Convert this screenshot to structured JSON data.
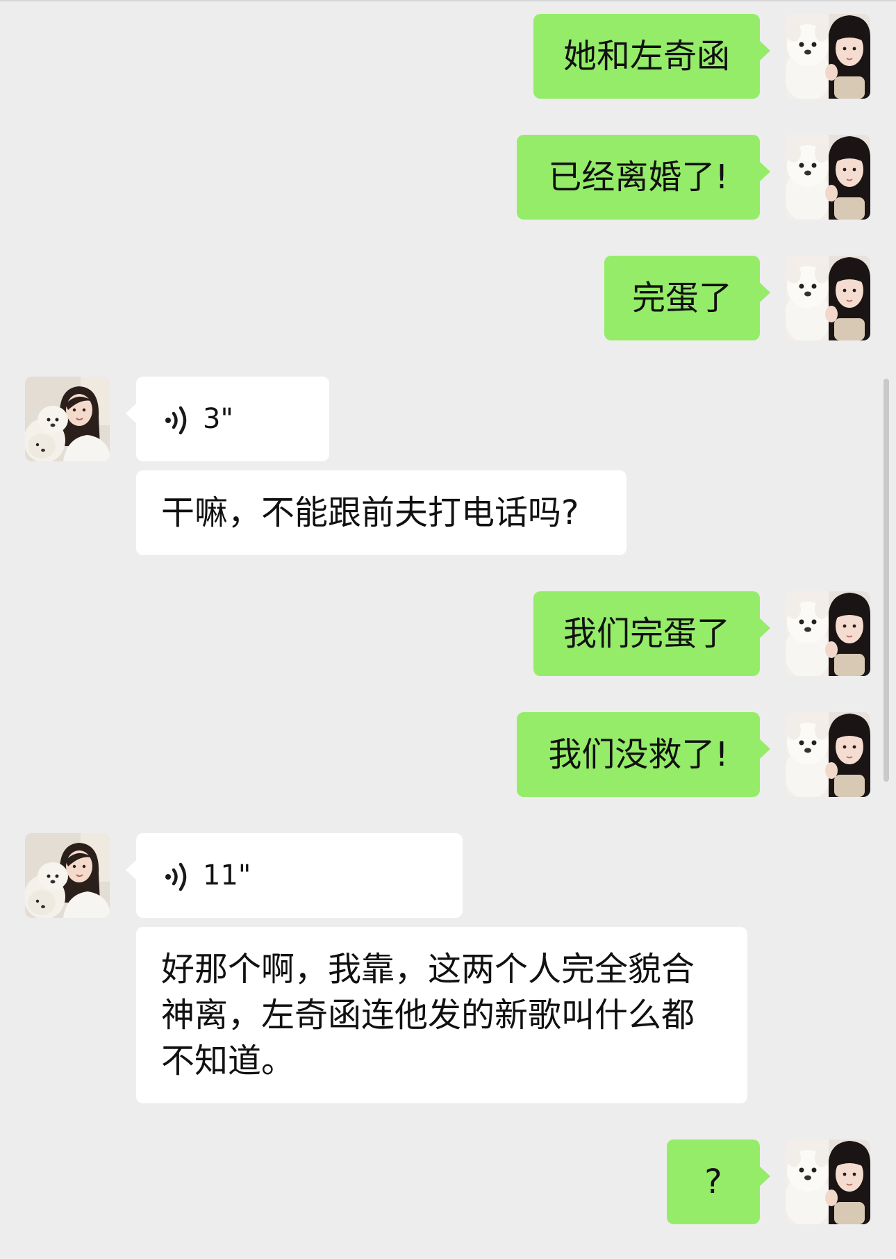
{
  "messages": [
    {
      "side": "right",
      "text": "她和左奇函"
    },
    {
      "side": "right",
      "text": "已经离婚了!"
    },
    {
      "side": "right",
      "text": "完蛋了"
    },
    {
      "side": "left",
      "type": "voice",
      "duration": "3\""
    },
    {
      "side": "left",
      "text": "干嘛，不能跟前夫打电话吗?"
    },
    {
      "side": "right",
      "text": "我们完蛋了"
    },
    {
      "side": "right",
      "text": "我们没救了!"
    },
    {
      "side": "left",
      "type": "voice",
      "duration": "11\""
    },
    {
      "side": "left",
      "text": "好那个啊，我靠，这两个人完全貌合神离，左奇函连他发的新歌叫什么都不知道。"
    },
    {
      "side": "right",
      "text": "?"
    }
  ],
  "colors": {
    "background": "#ededed",
    "my_bubble": "#95ec69",
    "their_bubble": "#ffffff"
  },
  "icons": {
    "voice": "voice-wave-icon",
    "my_avatar": "girl-with-white-plush-dog-avatar",
    "their_avatar": "woman-with-white-dog-avatar"
  }
}
